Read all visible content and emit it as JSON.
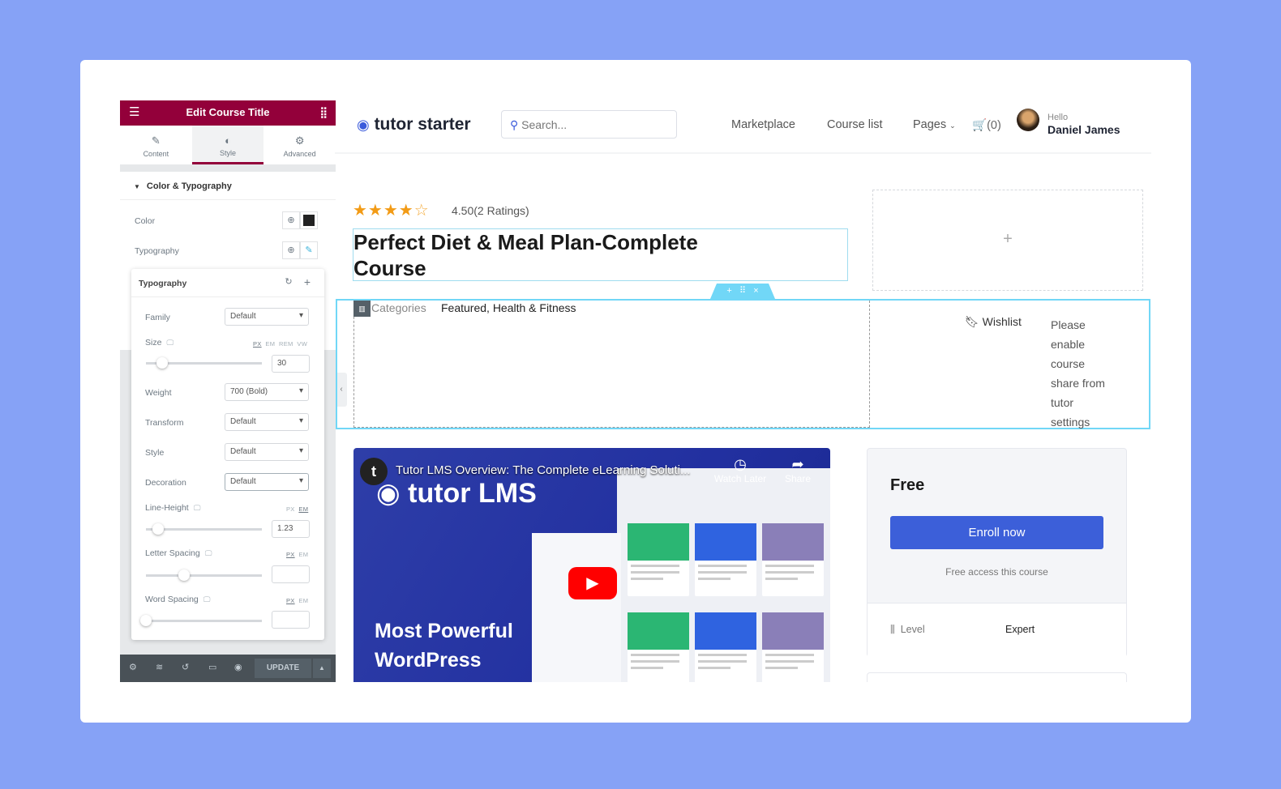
{
  "panel": {
    "title": "Edit Course Title",
    "tabs": [
      {
        "label": "Content",
        "icon": "pencil-icon"
      },
      {
        "label": "Style",
        "icon": "contrast-icon",
        "active": true
      },
      {
        "label": "Advanced",
        "icon": "gear-icon"
      }
    ],
    "section": "Color & Typography",
    "color_label": "Color",
    "color_value": "#222222",
    "typography_label": "Typography",
    "popup": {
      "title": "Typography",
      "family_label": "Family",
      "family": "Default",
      "size_label": "Size",
      "size_units": [
        "PX",
        "EM",
        "REM",
        "VW"
      ],
      "size_unit_active": "PX",
      "size": "30",
      "weight_label": "Weight",
      "weight": "700 (Bold)",
      "transform_label": "Transform",
      "transform": "Default",
      "style_label": "Style",
      "style": "Default",
      "decoration_label": "Decoration",
      "decoration": "Default",
      "line_height_label": "Line-Height",
      "line_height_units": [
        "PX",
        "EM"
      ],
      "line_height_unit_active": "EM",
      "line_height": "1.23",
      "letter_spacing_label": "Letter Spacing",
      "letter_spacing_units": [
        "PX",
        "EM"
      ],
      "letter_spacing_unit_active": "PX",
      "word_spacing_label": "Word Spacing",
      "word_spacing_units": [
        "PX",
        "EM"
      ],
      "word_spacing_unit_active": "PX"
    },
    "update_label": "UPDATE"
  },
  "header": {
    "logo": "tutor starter",
    "search_placeholder": "Search...",
    "nav": [
      "Marketplace",
      "Course list",
      "Pages"
    ],
    "cart": "(0)",
    "greeting": "Hello",
    "user": "Daniel James"
  },
  "course": {
    "rating": 4.5,
    "rating_text": "4.50(2 Ratings)",
    "title": "Perfect Diet & Meal Plan-Complete Course",
    "categories_label": "Categories",
    "categories": "Featured, Health & Fitness",
    "wishlist": "Wishlist",
    "share_notice": [
      "Please",
      "enable",
      "course",
      "share from",
      "tutor",
      "settings"
    ]
  },
  "video": {
    "title": "Tutor LMS Overview: The Complete eLearning Soluti...",
    "brand": "tutor LMS",
    "watch_later": "Watch Later",
    "share": "Share",
    "caption_line1": "Most Powerful",
    "caption_line2": "WordPress"
  },
  "pricing": {
    "price": "Free",
    "enroll": "Enroll now",
    "note": "Free access this course",
    "level_label": "Level",
    "level": "Expert"
  },
  "colors": {
    "background": "#86a2f6",
    "elementor": "#93003a",
    "enroll": "#3c5fd9",
    "star": "#f29b16",
    "editor_outline": "#5bc6e4"
  }
}
